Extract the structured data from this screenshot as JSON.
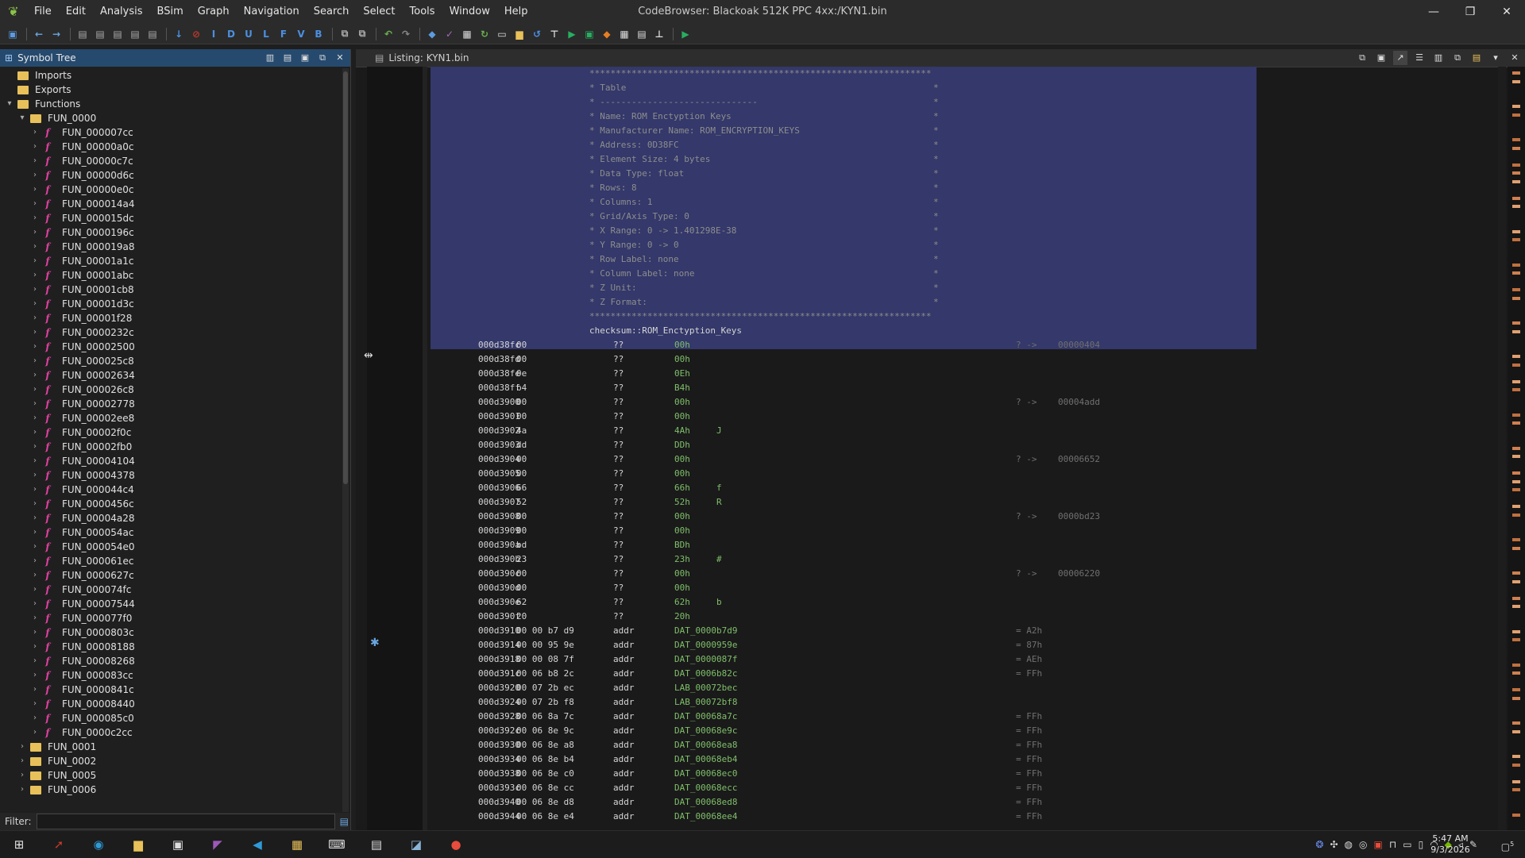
{
  "window": {
    "title": "CodeBrowser: Blackoak 512K PPC 4xx:/KYN1.bin",
    "controls": [
      "—",
      "❐",
      "✕"
    ]
  },
  "menu": [
    "File",
    "Edit",
    "Analysis",
    "BSim",
    "Graph",
    "Navigation",
    "Search",
    "Select",
    "Tools",
    "Window",
    "Help"
  ],
  "toolbar": {
    "letter_buttons": [
      "I",
      "D",
      "U",
      "L",
      "F",
      "V",
      "B"
    ]
  },
  "symbol_tree": {
    "title": "Symbol Tree",
    "top_items": [
      {
        "label": "Imports",
        "expanded": false
      },
      {
        "label": "Exports",
        "expanded": false
      },
      {
        "label": "Functions",
        "expanded": true
      }
    ],
    "open_folder": "FUN_0000",
    "functions": [
      "FUN_000007cc",
      "FUN_00000a0c",
      "FUN_00000c7c",
      "FUN_00000d6c",
      "FUN_00000e0c",
      "FUN_000014a4",
      "FUN_000015dc",
      "FUN_0000196c",
      "FUN_000019a8",
      "FUN_00001a1c",
      "FUN_00001abc",
      "FUN_00001cb8",
      "FUN_00001d3c",
      "FUN_00001f28",
      "FUN_0000232c",
      "FUN_00002500",
      "FUN_000025c8",
      "FUN_00002634",
      "FUN_000026c8",
      "FUN_00002778",
      "FUN_00002ee8",
      "FUN_00002f0c",
      "FUN_00002fb0",
      "FUN_00004104",
      "FUN_00004378",
      "FUN_000044c4",
      "FUN_0000456c",
      "FUN_00004a28",
      "FUN_000054ac",
      "FUN_000054e0",
      "FUN_000061ec",
      "FUN_0000627c",
      "FUN_000074fc",
      "FUN_00007544",
      "FUN_000077f0",
      "FUN_0000803c",
      "FUN_00008188",
      "FUN_00008268",
      "FUN_000083cc",
      "FUN_0000841c",
      "FUN_00008440",
      "FUN_000085c0",
      "FUN_0000c2cc"
    ],
    "other_folders": [
      "FUN_0001",
      "FUN_0002",
      "FUN_0005",
      "FUN_0006"
    ],
    "filter_label": "Filter:"
  },
  "listing": {
    "title": "Listing:  KYN1.bin",
    "comment_lines": [
      "*****************************************************************",
      "* Table",
      "* ------------------------------",
      "* Name: ROM Enctyption Keys",
      "* Manufacturer Name: ROM_ENCRYPTION_KEYS",
      "* Address: 0D38FC",
      "* Element Size: 4 bytes",
      "* Data Type: float",
      "* Rows: 8",
      "* Columns: 1",
      "* Grid/Axis Type: 0",
      "* X Range: 0 -> 1.401298E-38",
      "* Y Range: 0 -> 0",
      "* Row Label: none",
      "* Column Label: none",
      "* Z Unit:",
      "* Z Format:",
      "*****************************************************************"
    ],
    "label": "checksum::ROM_Enctyption_Keys",
    "rows": [
      {
        "addr": "000d38fc",
        "bytes": "00",
        "mn": "??",
        "op": "00h",
        "ch": "",
        "xr": "? ->",
        "xv": "00000404"
      },
      {
        "addr": "000d38fd",
        "bytes": "00",
        "mn": "??",
        "op": "00h",
        "ch": "",
        "xr": "",
        "xv": ""
      },
      {
        "addr": "000d38fe",
        "bytes": "0e",
        "mn": "??",
        "op": "0Eh",
        "ch": "",
        "xr": "",
        "xv": ""
      },
      {
        "addr": "000d38ff",
        "bytes": "b4",
        "mn": "??",
        "op": "B4h",
        "ch": "",
        "xr": "",
        "xv": ""
      },
      {
        "addr": "000d3900",
        "bytes": "00",
        "mn": "??",
        "op": "00h",
        "ch": "",
        "xr": "? ->",
        "xv": "00004add"
      },
      {
        "addr": "000d3901",
        "bytes": "00",
        "mn": "??",
        "op": "00h",
        "ch": "",
        "xr": "",
        "xv": ""
      },
      {
        "addr": "000d3902",
        "bytes": "4a",
        "mn": "??",
        "op": "4Ah",
        "ch": "J",
        "xr": "",
        "xv": ""
      },
      {
        "addr": "000d3903",
        "bytes": "dd",
        "mn": "??",
        "op": "DDh",
        "ch": "",
        "xr": "",
        "xv": ""
      },
      {
        "addr": "000d3904",
        "bytes": "00",
        "mn": "??",
        "op": "00h",
        "ch": "",
        "xr": "? ->",
        "xv": "00006652"
      },
      {
        "addr": "000d3905",
        "bytes": "00",
        "mn": "??",
        "op": "00h",
        "ch": "",
        "xr": "",
        "xv": ""
      },
      {
        "addr": "000d3906",
        "bytes": "66",
        "mn": "??",
        "op": "66h",
        "ch": "f",
        "xr": "",
        "xv": ""
      },
      {
        "addr": "000d3907",
        "bytes": "52",
        "mn": "??",
        "op": "52h",
        "ch": "R",
        "xr": "",
        "xv": ""
      },
      {
        "addr": "000d3908",
        "bytes": "00",
        "mn": "??",
        "op": "00h",
        "ch": "",
        "xr": "? ->",
        "xv": "0000bd23"
      },
      {
        "addr": "000d3909",
        "bytes": "00",
        "mn": "??",
        "op": "00h",
        "ch": "",
        "xr": "",
        "xv": ""
      },
      {
        "addr": "000d390a",
        "bytes": "bd",
        "mn": "??",
        "op": "BDh",
        "ch": "",
        "xr": "",
        "xv": ""
      },
      {
        "addr": "000d390b",
        "bytes": "23",
        "mn": "??",
        "op": "23h",
        "ch": "#",
        "xr": "",
        "xv": ""
      },
      {
        "addr": "000d390c",
        "bytes": "00",
        "mn": "??",
        "op": "00h",
        "ch": "",
        "xr": "? ->",
        "xv": "00006220"
      },
      {
        "addr": "000d390d",
        "bytes": "00",
        "mn": "??",
        "op": "00h",
        "ch": "",
        "xr": "",
        "xv": ""
      },
      {
        "addr": "000d390e",
        "bytes": "62",
        "mn": "??",
        "op": "62h",
        "ch": "b",
        "xr": "",
        "xv": ""
      },
      {
        "addr": "000d390f",
        "bytes": "20",
        "mn": "??",
        "op": "20h",
        "ch": "",
        "xr": "",
        "xv": ""
      },
      {
        "addr": "000d3910",
        "bytes": "00 00 b7 d9",
        "mn": "addr",
        "op": "DAT_0000b7d9",
        "ch": "",
        "xr": "= A2h",
        "xv": ""
      },
      {
        "addr": "000d3914",
        "bytes": "00 00 95 9e",
        "mn": "addr",
        "op": "DAT_0000959e",
        "ch": "",
        "xr": "= 87h",
        "xv": ""
      },
      {
        "addr": "000d3918",
        "bytes": "00 00 08 7f",
        "mn": "addr",
        "op": "DAT_0000087f",
        "ch": "",
        "xr": "= AEh",
        "xv": ""
      },
      {
        "addr": "000d391c",
        "bytes": "00 06 b8 2c",
        "mn": "addr",
        "op": "DAT_0006b82c",
        "ch": "",
        "xr": "= FFh",
        "xv": ""
      },
      {
        "addr": "000d3920",
        "bytes": "00 07 2b ec",
        "mn": "addr",
        "op": "LAB_00072bec",
        "ch": "",
        "xr": "",
        "xv": ""
      },
      {
        "addr": "000d3924",
        "bytes": "00 07 2b f8",
        "mn": "addr",
        "op": "LAB_00072bf8",
        "ch": "",
        "xr": "",
        "xv": ""
      },
      {
        "addr": "000d3928",
        "bytes": "00 06 8a 7c",
        "mn": "addr",
        "op": "DAT_00068a7c",
        "ch": "",
        "xr": "= FFh",
        "xv": ""
      },
      {
        "addr": "000d392c",
        "bytes": "00 06 8e 9c",
        "mn": "addr",
        "op": "DAT_00068e9c",
        "ch": "",
        "xr": "= FFh",
        "xv": ""
      },
      {
        "addr": "000d3930",
        "bytes": "00 06 8e a8",
        "mn": "addr",
        "op": "DAT_00068ea8",
        "ch": "",
        "xr": "= FFh",
        "xv": ""
      },
      {
        "addr": "000d3934",
        "bytes": "00 06 8e b4",
        "mn": "addr",
        "op": "DAT_00068eb4",
        "ch": "",
        "xr": "= FFh",
        "xv": ""
      },
      {
        "addr": "000d3938",
        "bytes": "00 06 8e c0",
        "mn": "addr",
        "op": "DAT_00068ec0",
        "ch": "",
        "xr": "= FFh",
        "xv": ""
      },
      {
        "addr": "000d393c",
        "bytes": "00 06 8e cc",
        "mn": "addr",
        "op": "DAT_00068ecc",
        "ch": "",
        "xr": "= FFh",
        "xv": ""
      },
      {
        "addr": "000d3940",
        "bytes": "00 06 8e d8",
        "mn": "addr",
        "op": "DAT_00068ed8",
        "ch": "",
        "xr": "= FFh",
        "xv": ""
      },
      {
        "addr": "000d3944",
        "bytes": "00 06 8e e4",
        "mn": "addr",
        "op": "DAT_00068ee4",
        "ch": "",
        "xr": "= FFh",
        "xv": ""
      }
    ]
  },
  "taskbar": {
    "time": "5:47 AM",
    "date": "9/3/2026",
    "notification_count": "5"
  },
  "colors": {
    "selection": "#34386a",
    "header_active": "#264a6e",
    "operand": "#7fbf6a",
    "function_icon": "#e040a0",
    "folder": "#e8c15a"
  }
}
